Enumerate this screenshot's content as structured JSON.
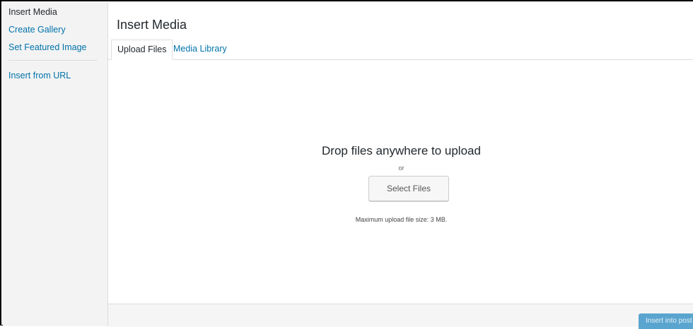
{
  "sidebar": {
    "items": [
      {
        "label": "Insert Media",
        "active": true
      },
      {
        "label": "Create Gallery"
      },
      {
        "label": "Set Featured Image"
      },
      {
        "label": "Insert from URL"
      }
    ]
  },
  "main": {
    "title": "Insert Media",
    "tabs": [
      {
        "label": "Upload Files",
        "active": true
      },
      {
        "label": "Media Library"
      }
    ],
    "upload": {
      "drop_text": "Drop files anywhere to upload",
      "or_text": "or",
      "select_button": "Select Files",
      "max_size": "Maximum upload file size: 3 MB."
    }
  },
  "footer": {
    "insert_button": "Insert into post"
  },
  "colors": {
    "link": "#0073aa",
    "text": "#23282d",
    "primary_disabled": "#5aa5cf",
    "sidebar_bg": "#f3f3f3"
  }
}
